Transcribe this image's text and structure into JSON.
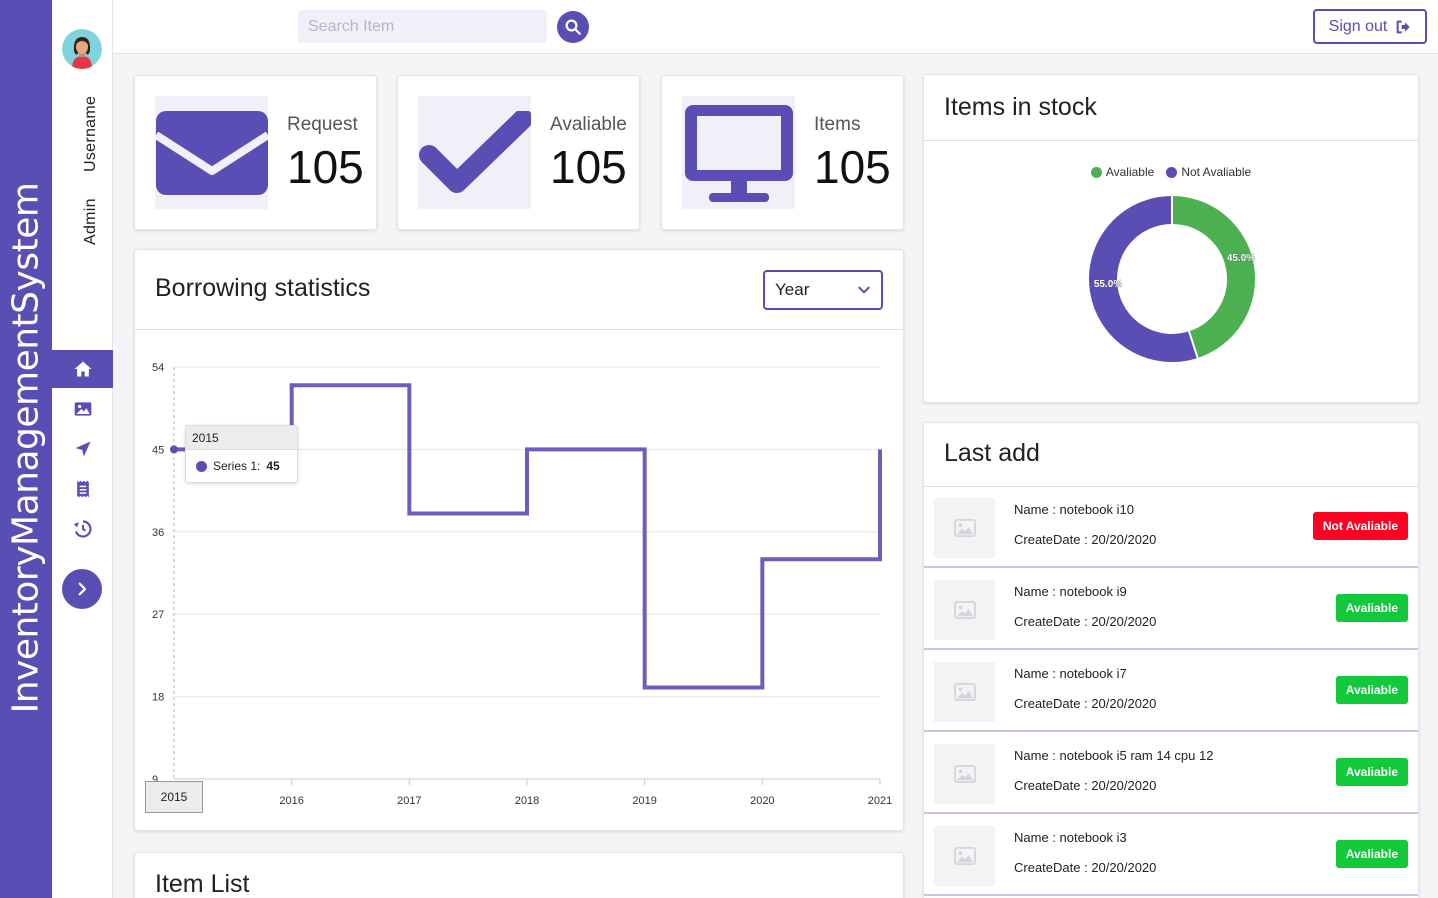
{
  "app": {
    "brand": "InventoryManagementSystem"
  },
  "user": {
    "name": "Username",
    "role": "Admin"
  },
  "sidebar": {
    "items": [
      {
        "icon": "home-icon",
        "active": true
      },
      {
        "icon": "image-icon",
        "active": false
      },
      {
        "icon": "location-arrow-icon",
        "active": false
      },
      {
        "icon": "receipt-icon",
        "active": false
      },
      {
        "icon": "history-icon",
        "active": false
      }
    ],
    "expand_icon": "chevron-right-icon"
  },
  "topbar": {
    "search_placeholder": "Search Item",
    "signout_label": "Sign out"
  },
  "stats": [
    {
      "label": "Request",
      "value": "105",
      "icon": "envelope-icon"
    },
    {
      "label": "Avaliable",
      "value": "105",
      "icon": "check-icon"
    },
    {
      "label": "Items",
      "value": "105",
      "icon": "monitor-icon"
    }
  ],
  "borrowing": {
    "title": "Borrowing statistics",
    "period": "Year"
  },
  "chart_data": {
    "type": "line",
    "step": true,
    "categories": [
      "2015",
      "2016",
      "2017",
      "2018",
      "2019",
      "2020",
      "2021"
    ],
    "series": [
      {
        "name": "Series 1",
        "values": [
          45,
          52,
          38,
          45,
          19,
          33,
          45
        ]
      }
    ],
    "yticks": [
      "54",
      "45",
      "36",
      "27",
      "18",
      "9"
    ],
    "ylim": [
      9,
      54
    ],
    "tooltip": {
      "category": "2015",
      "series": "Series 1:",
      "value": "45"
    },
    "colors": {
      "line": "#6a5fbc"
    }
  },
  "stock": {
    "title": "Items in stock",
    "legend": [
      "Avaliable",
      "Not Avaliable"
    ],
    "slices": [
      {
        "name": "Avaliable",
        "value": 45.0,
        "label": "45.0%",
        "color": "#4caf50"
      },
      {
        "name": "Not Avaliable",
        "value": 55.0,
        "label": "55.0%",
        "color": "#5a4db3"
      }
    ]
  },
  "last_add": {
    "title": "Last add",
    "items": [
      {
        "name": "Name : notebook i10",
        "date": "CreateDate : 20/20/2020",
        "status": "Not Avaliable",
        "color": "#ff0022"
      },
      {
        "name": "Name : notebook i9",
        "date": "CreateDate : 20/20/2020",
        "status": "Avaliable",
        "color": "#11c93a"
      },
      {
        "name": "Name : notebook i7",
        "date": "CreateDate : 20/20/2020",
        "status": "Avaliable",
        "color": "#11c93a"
      },
      {
        "name": "Name : notebook i5 ram 14 cpu 12",
        "date": "CreateDate : 20/20/2020",
        "status": "Avaliable",
        "color": "#11c93a"
      },
      {
        "name": "Name : notebook i3",
        "date": "CreateDate : 20/20/2020",
        "status": "Avaliable",
        "color": "#11c93a"
      }
    ]
  },
  "item_list": {
    "title": "Item List"
  },
  "colors": {
    "accent": "#5a4db3",
    "available": "#4caf50",
    "not_available": "#ff0022"
  }
}
